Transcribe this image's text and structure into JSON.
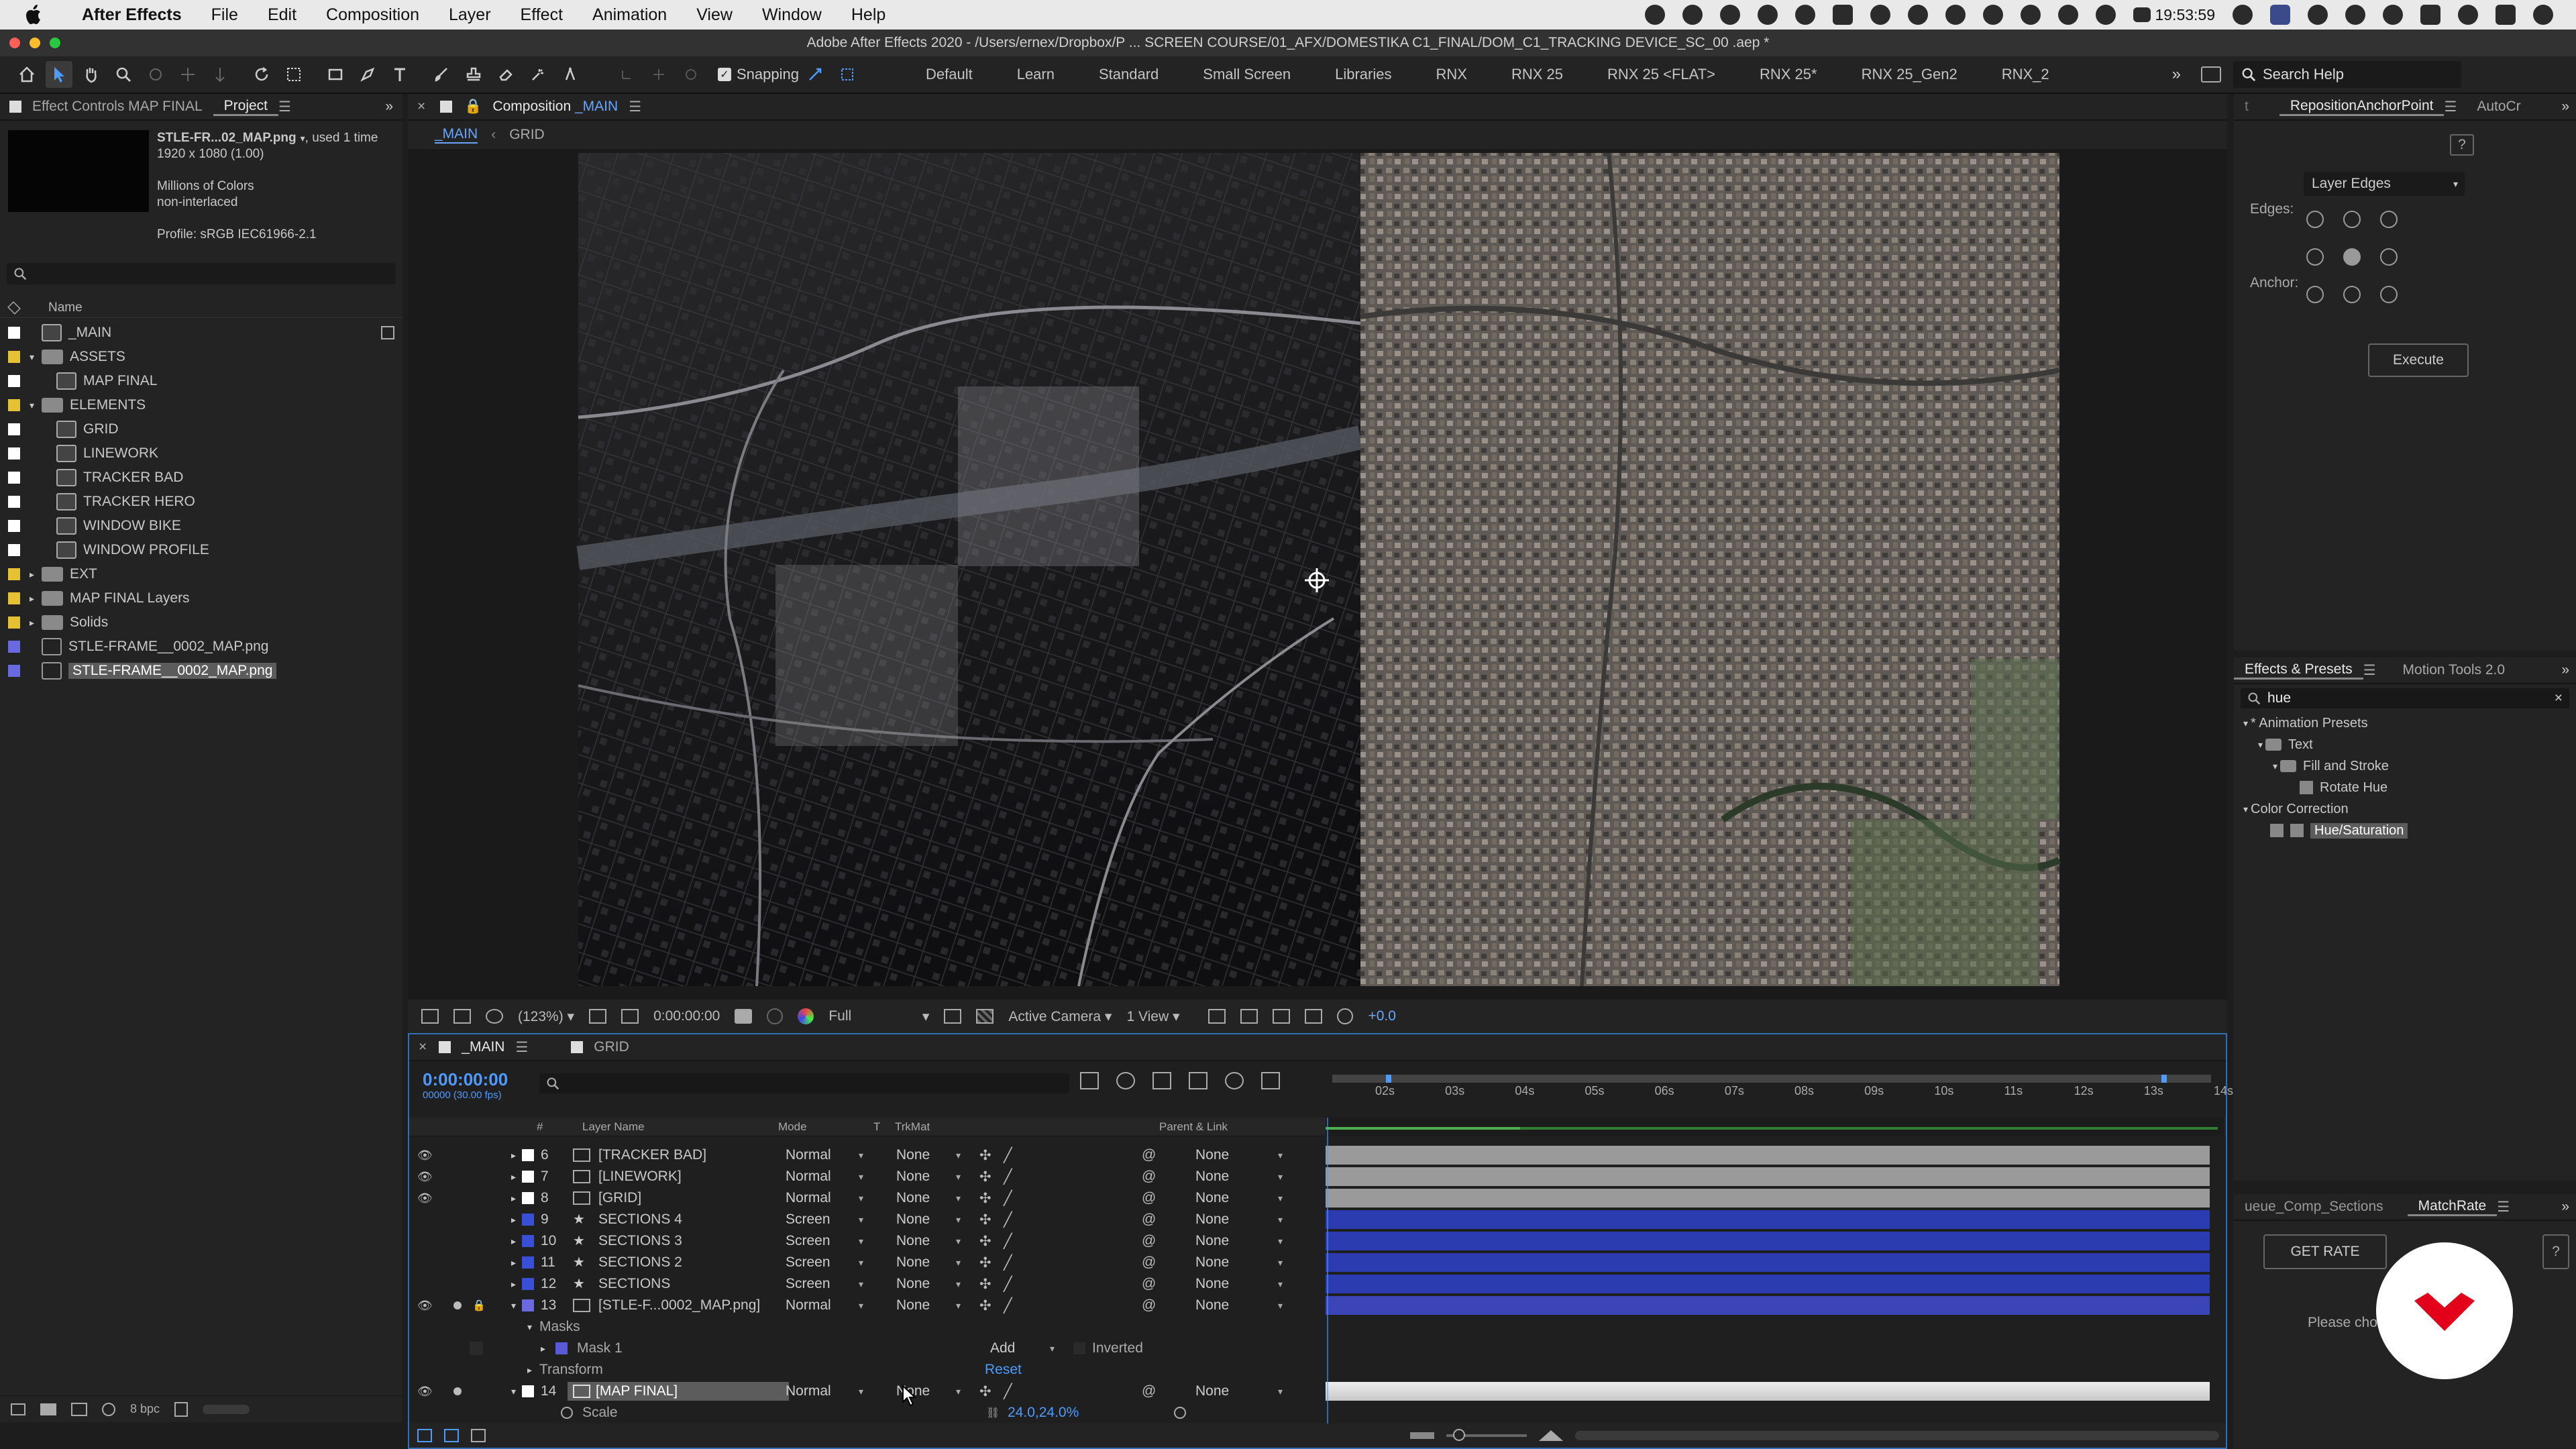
{
  "menubar": {
    "app_name": "After Effects",
    "menus": [
      "File",
      "Edit",
      "Composition",
      "Layer",
      "Effect",
      "Animation",
      "View",
      "Window",
      "Help"
    ],
    "time": "19:53:59"
  },
  "titlebar": {
    "title": "Adobe After Effects 2020 - /Users/ernex/Dropbox/P ... SCREEN COURSE/01_AFX/DOMESTIKA C1_FINAL/DOM_C1_TRACKING DEVICE_SC_00 .aep *"
  },
  "toolbar": {
    "snapping_label": "Snapping",
    "workspaces": [
      "Default",
      "Learn",
      "Standard",
      "Small Screen",
      "Libraries",
      "RNX",
      "RNX 25",
      "RNX 25 <FLAT>",
      "RNX 25*",
      "RNX 25_Gen2",
      "RNX_2"
    ],
    "search_placeholder": "Search Help"
  },
  "project": {
    "tabs": [
      "Effect Controls MAP FINAL",
      "Project"
    ],
    "preview": {
      "name": "STLE-FR...02_MAP.png",
      "used": ", used 1 time",
      "dimensions": "1920 x 1080 (1.00)",
      "colors": "Millions of Colors",
      "interlace": "non-interlaced",
      "profile": "Profile: sRGB IEC61966-2.1"
    },
    "column_name": "Name",
    "items": [
      {
        "name": "_MAIN",
        "type": "comp",
        "indent": 0,
        "label": "#ffffff"
      },
      {
        "name": "ASSETS",
        "type": "folder",
        "indent": 0,
        "label": "#e4c234",
        "open": true
      },
      {
        "name": "MAP FINAL",
        "type": "comp",
        "indent": 1,
        "label": "#ffffff"
      },
      {
        "name": "ELEMENTS",
        "type": "folder",
        "indent": 0,
        "label": "#e4c234",
        "open": true
      },
      {
        "name": "GRID",
        "type": "comp",
        "indent": 1,
        "label": "#ffffff"
      },
      {
        "name": "LINEWORK",
        "type": "comp",
        "indent": 1,
        "label": "#ffffff"
      },
      {
        "name": "TRACKER BAD",
        "type": "comp",
        "indent": 1,
        "label": "#ffffff"
      },
      {
        "name": "TRACKER HERO",
        "type": "comp",
        "indent": 1,
        "label": "#ffffff"
      },
      {
        "name": "WINDOW BIKE",
        "type": "comp",
        "indent": 1,
        "label": "#ffffff"
      },
      {
        "name": "WINDOW PROFILE",
        "type": "comp",
        "indent": 1,
        "label": "#ffffff"
      },
      {
        "name": "EXT",
        "type": "folder",
        "indent": 0,
        "label": "#e4c234",
        "open": false
      },
      {
        "name": "MAP FINAL Layers",
        "type": "folder",
        "indent": 0,
        "label": "#e4c234",
        "open": false
      },
      {
        "name": "Solids",
        "type": "folder",
        "indent": 0,
        "label": "#e4c234",
        "open": false
      },
      {
        "name": "STLE-FRAME__0002_MAP.png",
        "type": "file",
        "indent": 0,
        "label": "#6a6ae0"
      },
      {
        "name": "STLE-FRAME__0002_MAP.png",
        "type": "file",
        "indent": 0,
        "label": "#6a6ae0",
        "selected": true
      }
    ],
    "footer_bpc": "8 bpc"
  },
  "composition": {
    "tab_label": "Composition",
    "comp_name": "_MAIN",
    "breadcrumbs": [
      "_MAIN",
      "GRID"
    ],
    "zoom": "(123%)",
    "timecode": "0:00:00:00",
    "resolution": "Full",
    "camera": "Active Camera",
    "views": "1 View",
    "exposure": "+0.0"
  },
  "timeline": {
    "tabs": [
      "_MAIN",
      "GRID"
    ],
    "timecode": "0:00:00:00",
    "frame_info": "00000 (30.00 fps)",
    "headers": {
      "num": "#",
      "layer_name": "Layer Name",
      "mode": "Mode",
      "t": "T",
      "trkmat": "TrkMat",
      "parent": "Parent & Link"
    },
    "ruler": [
      "02s",
      "03s",
      "04s",
      "05s",
      "06s",
      "07s",
      "08s",
      "09s",
      "10s",
      "11s",
      "12s",
      "13s",
      "14s"
    ],
    "layers": [
      {
        "num": "6",
        "name": "[TRACKER BAD]",
        "mode": "Normal",
        "trkmat": "None",
        "parent": "None",
        "label": "#ffffff",
        "kind": "comp",
        "bar": "#9a9a9a"
      },
      {
        "num": "7",
        "name": "[LINEWORK]",
        "mode": "Normal",
        "trkmat": "None",
        "parent": "None",
        "label": "#ffffff",
        "kind": "comp",
        "bar": "#9a9a9a"
      },
      {
        "num": "8",
        "name": "[GRID]",
        "mode": "Normal",
        "trkmat": "None",
        "parent": "None",
        "label": "#ffffff",
        "kind": "comp",
        "bar": "#9a9a9a"
      },
      {
        "num": "9",
        "name": "SECTIONS 4",
        "mode": "Screen",
        "trkmat": "None",
        "parent": "None",
        "label": "#3a4fd8",
        "kind": "shape",
        "bar": "#2b3bb0"
      },
      {
        "num": "10",
        "name": "SECTIONS 3",
        "mode": "Screen",
        "trkmat": "None",
        "parent": "None",
        "label": "#3a4fd8",
        "kind": "shape",
        "bar": "#2b3bb0"
      },
      {
        "num": "11",
        "name": "SECTIONS 2",
        "mode": "Screen",
        "trkmat": "None",
        "parent": "None",
        "label": "#3a4fd8",
        "kind": "shape",
        "bar": "#2b3bb0"
      },
      {
        "num": "12",
        "name": "SECTIONS",
        "mode": "Screen",
        "trkmat": "None",
        "parent": "None",
        "label": "#3a4fd8",
        "kind": "shape",
        "bar": "#2b3bb0"
      },
      {
        "num": "13",
        "name": "[STLE-F...0002_MAP.png]",
        "mode": "Normal",
        "trkmat": "None",
        "parent": "None",
        "label": "#6a6ae0",
        "kind": "file",
        "bar": "#3b45b8"
      }
    ],
    "masks_label": "Masks",
    "mask1": {
      "name": "Mask 1",
      "mode": "Add",
      "inverted": "Inverted"
    },
    "transform_label": "Transform",
    "reset_label": "Reset",
    "layer14": {
      "num": "14",
      "name": "[MAP FINAL]",
      "mode": "Normal",
      "trkmat": "None",
      "parent": "None"
    },
    "scale_label": "Scale",
    "scale_value": "24.0,24.0%"
  },
  "reposition_panel": {
    "tab": "RepositionAnchorPoint",
    "tab2": "AutoCr",
    "help": "?",
    "dropdown": "Layer Edges",
    "edges_label": "Edges:",
    "anchor_label": "Anchor:",
    "execute": "Execute"
  },
  "effects_panel": {
    "tabs": [
      "Effects & Presets",
      "Motion Tools 2.0"
    ],
    "search_value": "hue",
    "tree": [
      {
        "label": "* Animation Presets",
        "indent": 0,
        "kind": "twirl"
      },
      {
        "label": "Text",
        "indent": 1,
        "kind": "folder"
      },
      {
        "label": "Fill and Stroke",
        "indent": 2,
        "kind": "folder"
      },
      {
        "label": "Rotate Hue",
        "indent": 3,
        "kind": "preset"
      },
      {
        "label": "Color Correction",
        "indent": 0,
        "kind": "twirl"
      },
      {
        "label": "Hue/Saturation",
        "indent": 1,
        "kind": "effect",
        "selected": true
      }
    ]
  },
  "matchrate_panel": {
    "tabs": [
      "ueue_Comp_Sections",
      "MatchRate"
    ],
    "button": "GET RATE",
    "message": "Please choos"
  }
}
